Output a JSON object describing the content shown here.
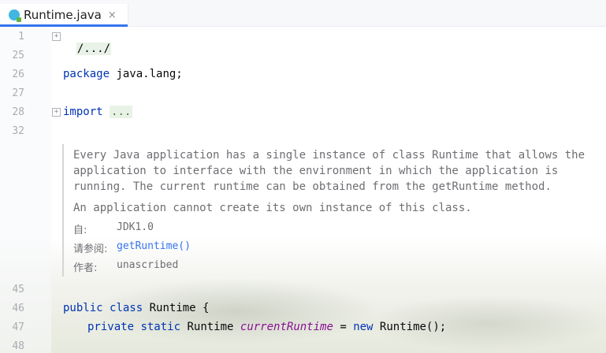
{
  "editor": {
    "tab": {
      "icon": "java-class-icon",
      "title": "Runtime.java",
      "close": "×"
    },
    "line_numbers": [
      "1",
      "25",
      "26",
      "27",
      "28",
      "32",
      "45",
      "46",
      "47",
      "48"
    ],
    "lines": {
      "l1_folded": "/.../",
      "l26_kw": "package",
      "l26_rest": " java.lang;",
      "l28_kw": "import",
      "l28_dots": "...",
      "l46_kw1": "public",
      "l46_kw2": "class",
      "l46_rest": " Runtime {",
      "l47_kw1": "private",
      "l47_kw2": "static",
      "l47_type": " Runtime ",
      "l47_field": "currentRuntime",
      "l47_eq": " = ",
      "l47_kw3": "new",
      "l47_rest": " Runtime();"
    },
    "doc": {
      "para1_line1": "Every Java application has a single instance of class Runtime that allows the",
      "para1_line2": "application to interface with the environment in which the application is",
      "para1_line3": "running. The current runtime can be obtained from the getRuntime method.",
      "para2": "An application cannot create its own instance of this class.",
      "since_label": "自:",
      "since_value": "JDK1.0",
      "see_label": "请参阅:",
      "see_value": "getRuntime()",
      "author_label": "作者:",
      "author_value": "unascribed"
    }
  }
}
